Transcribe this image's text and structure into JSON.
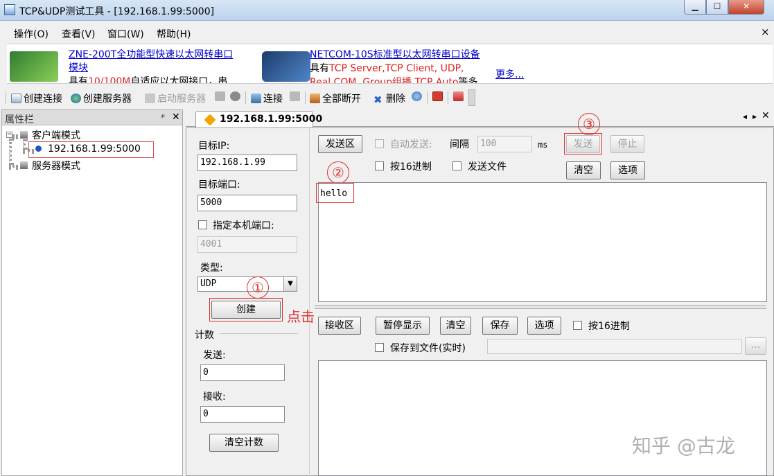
{
  "window": {
    "title": "TCP&UDP测试工具 - [192.168.1.99:5000]",
    "min": "▁",
    "max": "☐",
    "close": "✕"
  },
  "menu": {
    "items": [
      "操作(O)",
      "查看(V)",
      "窗口(W)",
      "帮助(H)"
    ],
    "close": "×"
  },
  "banner": {
    "ad1_title": "ZNE-200T全功能型快速以太网转串口",
    "ad1_title2": "模块",
    "ad1_p1": "具有",
    "ad1_p2": "10/100M",
    "ad1_p3": "自适应以太网接口，串",
    "ad2_title": "NETCOM-10S标准型以太网转串口设备",
    "ad2_p1": "具有",
    "ad2_p2": "TCP Server,TCP Client, UDP,",
    "ad2_p3": "Real COM ,Group组播,TCP Auto",
    "ad2_p4": "等多",
    "more": "更多..."
  },
  "toolbar": {
    "create_connection": "创建连接",
    "create_server": "创建服务器",
    "start_server": "启动服务器",
    "connect": "连接",
    "disconnect_all": "全部断开",
    "delete": "删除"
  },
  "sidebar": {
    "title": "属性栏",
    "pin": "ᵖ",
    "close": "✕",
    "client_mode": "客户端模式",
    "client_item": "192.168.1.99:5000",
    "server_mode": "服务器模式"
  },
  "tab": {
    "label": "192.168.1.99:5000",
    "prev": "◂",
    "next": "▸",
    "close": "✕"
  },
  "form": {
    "target_ip_label": "目标IP:",
    "target_ip": "192.168.1.99",
    "target_port_label": "目标端口:",
    "target_port": "5000",
    "local_port_label": "指定本机端口:",
    "local_port": "4001",
    "type_label": "类型:",
    "type_value": "UDP",
    "create_button": "创建",
    "click_hint": "点击",
    "count_label": "计数",
    "send_count_label": "发送:",
    "send_count": "0",
    "recv_count_label": "接收:",
    "recv_count": "0",
    "clear_count": "清空计数"
  },
  "send_area": {
    "tab": "发送区",
    "auto_send": "自动发送:",
    "interval_label": "间隔",
    "interval_value": "100",
    "interval_unit": "ms",
    "send": "发送",
    "stop": "停止",
    "hex": "按16进制",
    "send_file": "发送文件",
    "clear": "清空",
    "options": "选项",
    "content": "hello"
  },
  "recv_area": {
    "tab": "接收区",
    "pause": "暂停显示",
    "clear": "清空",
    "save": "保存",
    "options": "选项",
    "hex": "按16进制",
    "save_to_file": "保存到文件(实时)",
    "browse": "..."
  },
  "annotations": {
    "step1": "①",
    "step2": "②",
    "step3": "③"
  },
  "watermark": "知乎 @古龙"
}
